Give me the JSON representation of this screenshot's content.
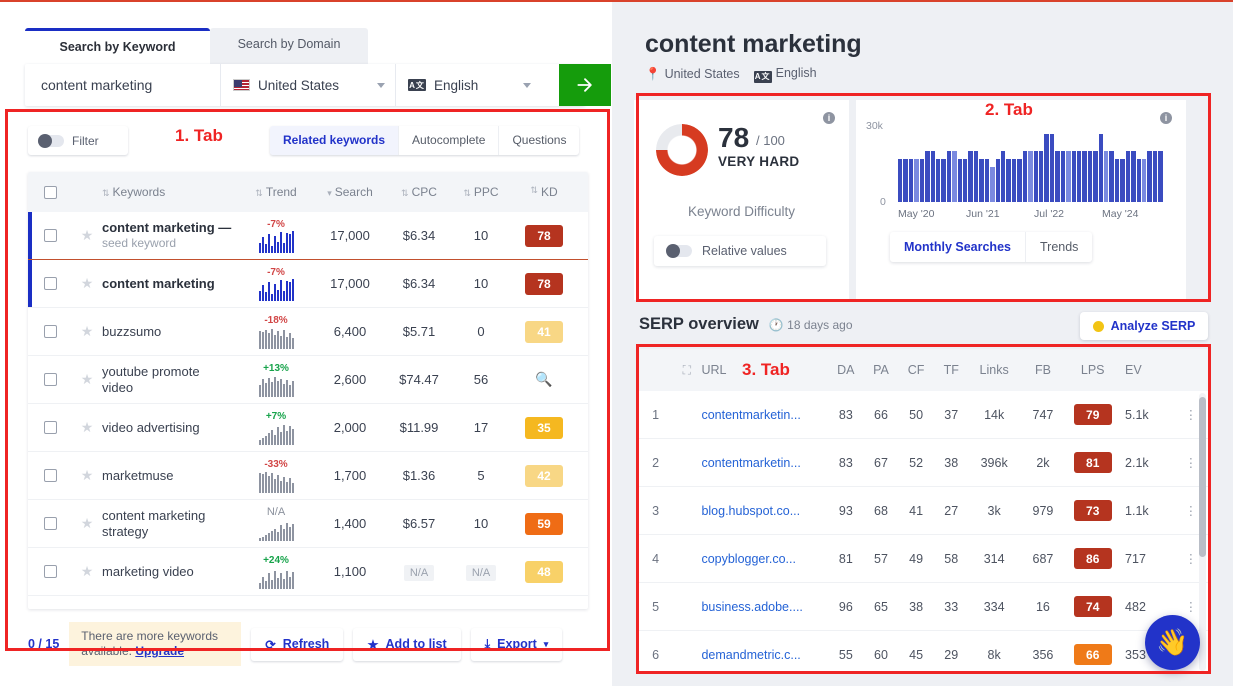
{
  "left": {
    "top_tabs": [
      {
        "label": "Search by Keyword",
        "active": true
      },
      {
        "label": "Search by Domain",
        "active": false
      }
    ],
    "search": {
      "keyword": "content marketing",
      "country": "United States",
      "language": "English",
      "go_icon": "arrow-right-icon"
    },
    "filter_label": "Filter",
    "annotation_1": "1. Tab",
    "keyword_tabs": [
      {
        "label": "Related keywords",
        "active": true
      },
      {
        "label": "Autocomplete",
        "active": false
      },
      {
        "label": "Questions",
        "active": false
      }
    ],
    "table": {
      "columns": [
        "Keywords",
        "Trend",
        "Search",
        "CPC",
        "PPC",
        "KD"
      ],
      "rows": [
        {
          "keyword": "content marketing",
          "dash": "—",
          "sub": "seed keyword",
          "trend": "-7%",
          "trend_dir": "neg",
          "search": "17,000",
          "cpc": "$6.34",
          "ppc": "10",
          "kd": "78",
          "kd_color": "#b5341f",
          "selected": true,
          "spark": [
            10,
            16,
            9,
            19,
            7,
            17,
            11,
            21,
            10,
            20,
            19,
            22
          ]
        },
        {
          "keyword": "content marketing",
          "dash": "",
          "sub": "",
          "trend": "-7%",
          "trend_dir": "neg",
          "search": "17,000",
          "cpc": "$6.34",
          "ppc": "10",
          "kd": "78",
          "kd_color": "#b5341f",
          "selected": true,
          "spark": [
            10,
            16,
            9,
            19,
            7,
            17,
            11,
            21,
            10,
            20,
            19,
            22
          ]
        },
        {
          "keyword": "buzzsumo",
          "dash": "",
          "sub": "",
          "trend": "-18%",
          "trend_dir": "neg",
          "search": "6,400",
          "cpc": "$5.71",
          "ppc": "0",
          "kd": "41",
          "kd_color": "#f8d785",
          "selected": false,
          "spark": [
            18,
            17,
            19,
            16,
            20,
            14,
            18,
            13,
            19,
            12,
            16,
            11
          ]
        },
        {
          "keyword": "youtube promote",
          "dash": "",
          "sub": "video",
          "trend": "+13%",
          "trend_dir": "pos",
          "search": "2,600",
          "cpc": "$74.47",
          "ppc": "56",
          "kd": "",
          "kd_color": "",
          "selected": false,
          "spark": [
            12,
            18,
            14,
            19,
            15,
            20,
            16,
            18,
            13,
            17,
            12,
            16
          ]
        },
        {
          "keyword": "video advertising",
          "dash": "",
          "sub": "",
          "trend": "+7%",
          "trend_dir": "pos",
          "search": "2,000",
          "cpc": "$11.99",
          "ppc": "17",
          "kd": "35",
          "kd_color": "#f5b820",
          "selected": false,
          "spark": [
            5,
            7,
            9,
            12,
            15,
            10,
            18,
            13,
            20,
            14,
            19,
            16
          ]
        },
        {
          "keyword": "marketmuse",
          "dash": "",
          "sub": "",
          "trend": "-33%",
          "trend_dir": "neg",
          "search": "1,700",
          "cpc": "$1.36",
          "ppc": "5",
          "kd": "42",
          "kd_color": "#f8d785",
          "selected": false,
          "spark": [
            20,
            19,
            21,
            17,
            20,
            14,
            18,
            12,
            16,
            11,
            15,
            10
          ]
        },
        {
          "keyword": "content marketing",
          "dash": "",
          "sub": "strategy",
          "trend": "N/A",
          "trend_dir": "na",
          "search": "1,400",
          "cpc": "$6.57",
          "ppc": "10",
          "kd": "59",
          "kd_color": "#ef6c15",
          "selected": false,
          "spark": [
            3,
            4,
            6,
            8,
            10,
            12,
            9,
            16,
            12,
            18,
            14,
            17
          ]
        },
        {
          "keyword": "marketing video",
          "dash": "",
          "sub": "",
          "trend": "+24%",
          "trend_dir": "pos",
          "search": "1,100",
          "cpc": "N/A",
          "ppc": "N/A",
          "kd": "48",
          "kd_color": "#f8d168",
          "selected": false,
          "spark": [
            6,
            12,
            8,
            16,
            9,
            18,
            11,
            16,
            10,
            18,
            12,
            17
          ]
        }
      ]
    },
    "footer": {
      "count": "0 / 15",
      "upsell_text": "There are more keywords available.",
      "upsell_link": "Upgrade",
      "refresh_label": "Refresh",
      "addlist_label": "Add to list",
      "export_label": "Export"
    }
  },
  "right": {
    "title": "content marketing",
    "country": "United States",
    "language": "English",
    "annotation_2": "2. Tab",
    "annotation_3": "3. Tab",
    "difficulty": {
      "score": "78",
      "out_of": "/ 100",
      "verdict": "VERY HARD",
      "caption": "Keyword Difficulty",
      "relative_label": "Relative values"
    },
    "chart_tabs": [
      {
        "label": "Monthly Searches",
        "active": true
      },
      {
        "label": "Trends",
        "active": false
      }
    ],
    "serp": {
      "title": "SERP overview",
      "updated": "18 days ago",
      "analyze_label": "Analyze SERP",
      "columns": [
        "URL",
        "DA",
        "PA",
        "CF",
        "TF",
        "Links",
        "FB",
        "LPS",
        "EV"
      ],
      "rows": [
        {
          "n": "1",
          "url": "contentmarketin...",
          "da": "83",
          "pa": "66",
          "cf": "50",
          "tf": "37",
          "links": "14k",
          "fb": "747",
          "lps": "79",
          "lps_color": "#b5341f",
          "ev": "5.1k"
        },
        {
          "n": "2",
          "url": "contentmarketin...",
          "da": "83",
          "pa": "67",
          "cf": "52",
          "tf": "38",
          "links": "396k",
          "fb": "2k",
          "lps": "81",
          "lps_color": "#b5341f",
          "ev": "2.1k"
        },
        {
          "n": "3",
          "url": "blog.hubspot.co...",
          "da": "93",
          "pa": "68",
          "cf": "41",
          "tf": "27",
          "links": "3k",
          "fb": "979",
          "lps": "73",
          "lps_color": "#b5341f",
          "ev": "1.1k"
        },
        {
          "n": "4",
          "url": "copyblogger.co...",
          "da": "81",
          "pa": "57",
          "cf": "49",
          "tf": "58",
          "links": "314",
          "fb": "687",
          "lps": "86",
          "lps_color": "#b5341f",
          "ev": "717"
        },
        {
          "n": "5",
          "url": "business.adobe....",
          "da": "96",
          "pa": "65",
          "cf": "38",
          "tf": "33",
          "links": "334",
          "fb": "16",
          "lps": "74",
          "lps_color": "#b5341f",
          "ev": "482"
        },
        {
          "n": "6",
          "url": "demandmetric.c...",
          "da": "55",
          "pa": "60",
          "cf": "45",
          "tf": "29",
          "links": "8k",
          "fb": "356",
          "lps": "66",
          "lps_color": "#ef7a18",
          "ev": "353"
        }
      ]
    },
    "chat_icon": "waving-hand-icon"
  },
  "chart_data": {
    "type": "bar",
    "title": "Monthly Searches",
    "xlabel": "",
    "ylabel": "",
    "ylim": [
      0,
      30000
    ],
    "ytick_labels": [
      "0",
      "30k"
    ],
    "xtick_labels": [
      "May '20",
      "Jun '21",
      "Jul '22",
      "May '24"
    ],
    "grid": false,
    "legend": null,
    "categories": [
      "May '20",
      "Jun '20",
      "Jul '20",
      "Aug '20",
      "Sep '20",
      "Oct '20",
      "Nov '20",
      "Dec '20",
      "Jan '21",
      "Feb '21",
      "Mar '21",
      "Apr '21",
      "May '21",
      "Jun '21",
      "Jul '21",
      "Aug '21",
      "Sep '21",
      "Oct '21",
      "Nov '21",
      "Dec '21",
      "Jan '22",
      "Feb '22",
      "Mar '22",
      "Apr '22",
      "May '22",
      "Jun '22",
      "Jul '22",
      "Aug '22",
      "Sep '22",
      "Oct '22",
      "Nov '22",
      "Dec '22",
      "Jan '23",
      "Feb '23",
      "Mar '23",
      "Apr '23",
      "May '23",
      "Jun '23",
      "Jul '23",
      "Aug '23",
      "Sep '23",
      "Oct '23",
      "Nov '23",
      "Dec '23",
      "Jan '24",
      "Feb '24",
      "Mar '24",
      "Apr '24",
      "May '24"
    ],
    "values": [
      17000,
      17000,
      17000,
      17000,
      17000,
      20000,
      20000,
      17000,
      17000,
      20000,
      20000,
      17000,
      17000,
      20000,
      20000,
      17000,
      17000,
      14000,
      17000,
      20000,
      17000,
      17000,
      17000,
      20000,
      20000,
      20000,
      20000,
      27000,
      27000,
      20000,
      20000,
      20000,
      20000,
      20000,
      20000,
      20000,
      20000,
      27000,
      20000,
      20000,
      17000,
      17000,
      20000,
      20000,
      17000,
      17000,
      20000,
      20000,
      20000
    ]
  }
}
